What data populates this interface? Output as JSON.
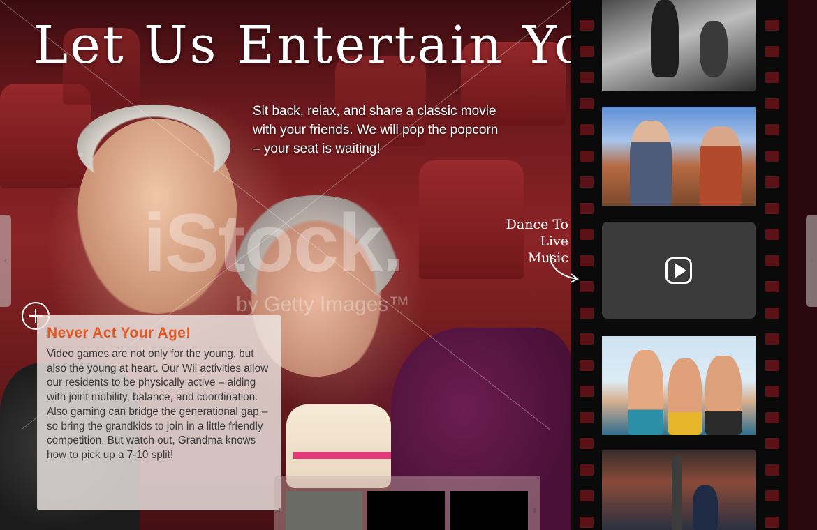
{
  "hero": {
    "title": "Let Us Entertain You",
    "intro": "Sit back, relax, and share a classic movie with your friends. We will pop the popcorn – your seat is waiting!",
    "watermark": "iStock.",
    "watermark_sub": "by Getty Images™"
  },
  "card": {
    "title": "Never Act Your Age!",
    "body": "Video games are not only for the young, but also the young at heart. Our Wii activities allow our residents to be physically active – aiding with joint mobility, balance, and coordination. Also gaming can bridge the generational gap – so bring the grandkids to join in a little friendly competition. But watch out, Grandma knows how to pick up a 7-10 split!"
  },
  "film": {
    "dance_label": "Dance To Live Music"
  },
  "icons": {
    "left_arrow": "‹",
    "right_arrow": "›",
    "plus": "plus-icon",
    "play": "play-icon"
  },
  "colors": {
    "accent": "#e15a25",
    "background": "#6e1a1e",
    "film": "#0a0a0a"
  }
}
